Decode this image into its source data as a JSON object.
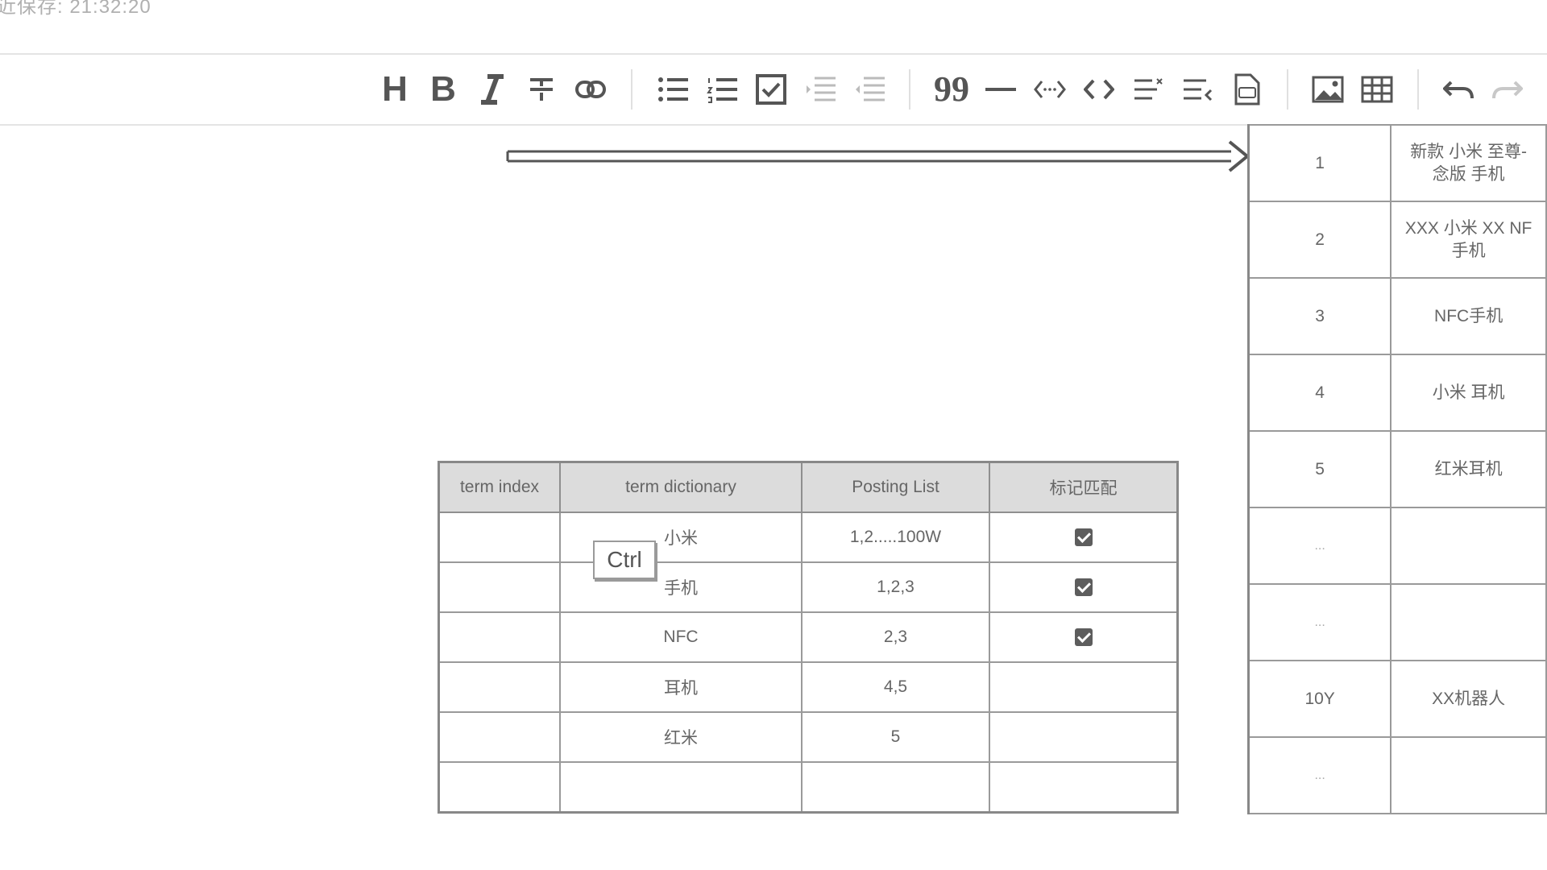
{
  "status": {
    "save_text": "近保存: 21:32:20"
  },
  "toolbar": {
    "buttons": [
      {
        "name": "heading-icon",
        "label": "H"
      },
      {
        "name": "bold-icon",
        "label": "B"
      },
      {
        "name": "italic-icon"
      },
      {
        "name": "strikethrough-icon"
      },
      {
        "name": "link-icon"
      },
      {
        "name": "bullet-list-icon"
      },
      {
        "name": "numbered-list-icon"
      },
      {
        "name": "checklist-icon"
      },
      {
        "name": "indent-icon"
      },
      {
        "name": "outdent-icon"
      },
      {
        "name": "quote-icon"
      },
      {
        "name": "horizontal-rule-icon"
      },
      {
        "name": "inline-code-icon"
      },
      {
        "name": "code-block-icon"
      },
      {
        "name": "insert-before-icon"
      },
      {
        "name": "insert-after-icon"
      },
      {
        "name": "export-pdf-icon"
      },
      {
        "name": "image-icon"
      },
      {
        "name": "table-icon"
      },
      {
        "name": "undo-icon"
      },
      {
        "name": "redo-icon"
      }
    ]
  },
  "term_table": {
    "headers": [
      "term index",
      "term dictionary",
      "Posting List",
      "标记匹配"
    ],
    "rows": [
      {
        "index": "",
        "term": "小米",
        "postings": "1,2.....100W",
        "matched": true
      },
      {
        "index": "",
        "term": "手机",
        "postings": "1,2,3",
        "matched": true
      },
      {
        "index": "",
        "term": "NFC",
        "postings": "2,3",
        "matched": true
      },
      {
        "index": "",
        "term": "耳机",
        "postings": "4,5",
        "matched": false
      },
      {
        "index": "",
        "term": "红米",
        "postings": "5",
        "matched": false
      },
      {
        "index": "",
        "term": "",
        "postings": "",
        "matched": false
      }
    ]
  },
  "keyboard_hint": {
    "label": "Ctrl"
  },
  "doc_table": {
    "rows": [
      {
        "id": "1",
        "text": "新款 小米 至尊-\n念版 手机"
      },
      {
        "id": "2",
        "text": "XXX 小米 XX NF\n手机"
      },
      {
        "id": "3",
        "text": "NFC手机"
      },
      {
        "id": "4",
        "text": "小米 耳机"
      },
      {
        "id": "5",
        "text": "红米耳机"
      },
      {
        "id": "...",
        "text": ""
      },
      {
        "id": "...",
        "text": ""
      },
      {
        "id": "10Y",
        "text": "XX机器人"
      },
      {
        "id": "...",
        "text": ""
      }
    ]
  },
  "colors": {
    "checkbox": "#5d5d5d",
    "header_bg": "#dcdcdc",
    "icon": "#555555"
  }
}
